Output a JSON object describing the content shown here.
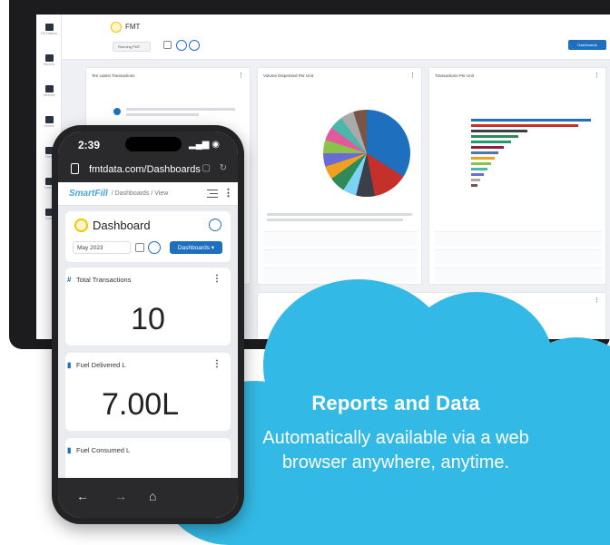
{
  "desktop": {
    "sidebar": [
      "Fill Stations",
      "Reports",
      "Vehicles",
      "Drivers",
      "Fuels",
      "Users",
      "Tools"
    ],
    "title": "FMT",
    "date": "Running FMT",
    "dashboards_btn": "Dashboards",
    "panels": {
      "latest": "Ten Latest Transactions",
      "volume": "Volume Dispensed Per Unit",
      "transactions": "Transactions Per Unit"
    }
  },
  "phone": {
    "time": "2:39",
    "url": "fmtdata.com/Dashboards",
    "brand": "SmartFill",
    "breadcrumb": "/ Dashboards / View",
    "dashboard_title": "Dashboard",
    "date": "May 2023",
    "dashboards_btn": "Dashboards",
    "cards": [
      {
        "title": "Total Transactions",
        "value": "10"
      },
      {
        "title": "Fuel Delivered L",
        "value": "7.00L"
      },
      {
        "title": "Fuel Consumed L",
        "value": ""
      }
    ]
  },
  "cloud": {
    "title": "Reports and Data",
    "subtitle_line1": "Automatically available via a web",
    "subtitle_line2": "browser anywhere, anytime."
  },
  "colors": {
    "cloud": "#33b9e5",
    "accent": "#1f6fbf",
    "logo": "#f5c400"
  }
}
